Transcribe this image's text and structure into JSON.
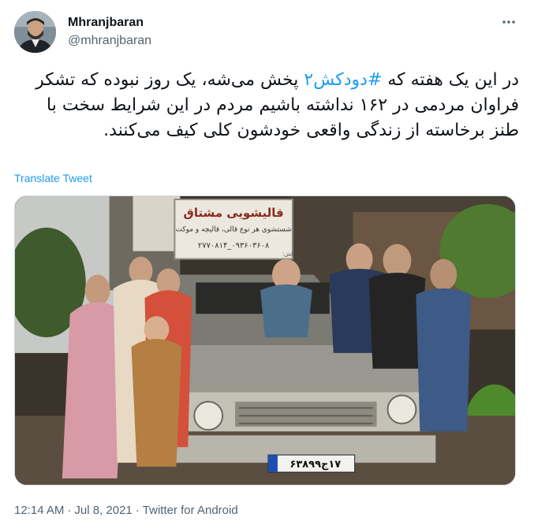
{
  "user": {
    "display_name": "Mhranjbaran",
    "handle": "@mhranjbaran"
  },
  "tweet": {
    "text_before": "در این یک هفته که ",
    "hashtag": "#دودکش۲",
    "text_after": " پخش می‌شه، یک روز نبوده که تشکر فراوان مردمی در ۱۶۲ نداشته باشیم مردم در این شرایط سخت با طنز برخاسته از زندگی واقعی خودشون کلی کیف می‌کنند.",
    "translate_label": "Translate Tweet"
  },
  "media": {
    "sign_title": "قالیشویی مشتاق",
    "sign_line2": "شستشوی هر نوع قالی، قالیچه و موکت",
    "sign_phone": "۰۹۳۶۰۳۶۰۸_۲۷۷۰۸۱۴",
    "sign_small": "کش:",
    "plate_text": "۱۷ج۶۳۸۹۹"
  },
  "footer": {
    "time": "12:14 AM",
    "date": "Jul 8, 2021",
    "separator": "·",
    "source": "Twitter for Android"
  },
  "icons": {
    "more": "more-options-icon"
  },
  "colors": {
    "accent": "#1d9bf0",
    "secondary_text": "#536471",
    "primary_text": "#0f1419"
  }
}
